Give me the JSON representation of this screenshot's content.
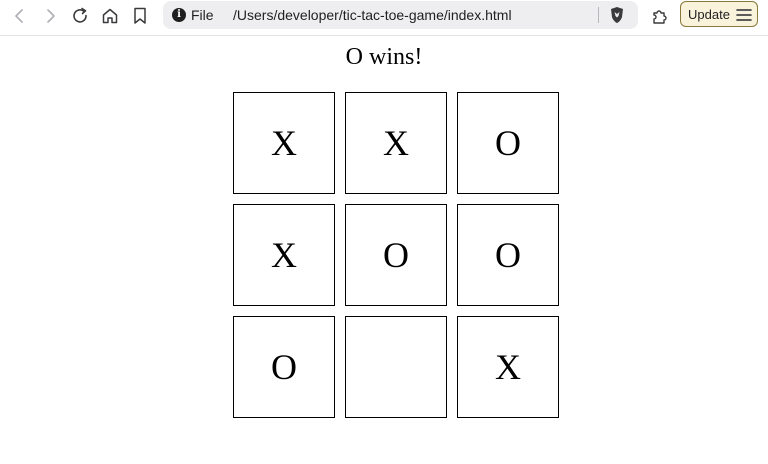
{
  "browser": {
    "scheme_label": "File",
    "url": "/Users/developer/tic-tac-toe-game/index.html",
    "update_label": "Update",
    "icons": {
      "back": "chevron-left-icon",
      "forward": "chevron-right-icon",
      "reload": "reload-icon",
      "home": "home-icon",
      "bookmark": "bookmark-icon",
      "site_info": "info-icon",
      "shields": "brave-shield-icon",
      "extensions": "puzzle-icon",
      "menu": "hamburger-menu-icon"
    },
    "colors": {
      "update_accent": "#faf3dc"
    }
  },
  "game": {
    "status": "O wins!",
    "board": [
      {
        "mark": "X"
      },
      {
        "mark": "X"
      },
      {
        "mark": "O"
      },
      {
        "mark": "X"
      },
      {
        "mark": "O"
      },
      {
        "mark": "O"
      },
      {
        "mark": "O"
      },
      {
        "mark": ""
      },
      {
        "mark": "X"
      }
    ]
  }
}
